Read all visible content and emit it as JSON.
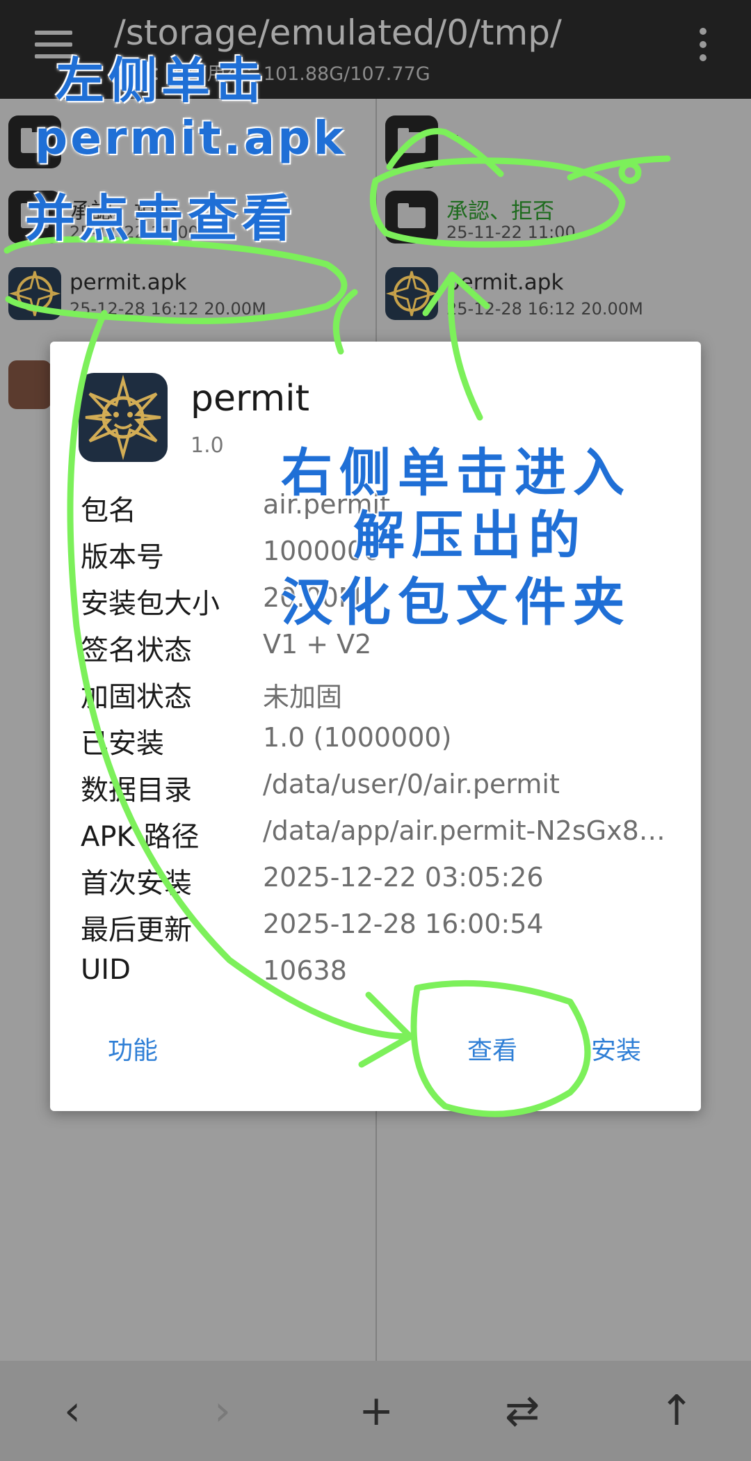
{
  "topbar": {
    "path": "/storage/emulated/0/tmp/",
    "storage_line": "文件：1 可用存：101.88G/107.77G"
  },
  "left_pane": {
    "rows": [
      {
        "name": "..",
        "meta": ""
      },
      {
        "name": "承認、拒否",
        "meta": "25-11-22 11:00"
      },
      {
        "name": "permit.apk",
        "meta": "25-12-28 16:12  20.00M"
      }
    ]
  },
  "right_pane": {
    "rows": [
      {
        "name": "..",
        "meta": ""
      },
      {
        "name": "承認、拒否",
        "meta": "25-11-22 11:00"
      },
      {
        "name": "permit.apk",
        "meta": "25-12-28 16:12  20.00M"
      }
    ]
  },
  "dialog": {
    "app_name": "permit",
    "version": "1.0",
    "rows": [
      {
        "label": "包名",
        "value": "air.permit"
      },
      {
        "label": "版本号",
        "value": "1000000"
      },
      {
        "label": "安装包大小",
        "value": "20.00M"
      },
      {
        "label": "签名状态",
        "value": "V1 + V2"
      },
      {
        "label": "加固状态",
        "value": "未加固"
      },
      {
        "label": "已安装",
        "value": "1.0 (1000000)"
      },
      {
        "label": "数据目录",
        "value": "/data/user/0/air.permit"
      },
      {
        "label": "APK 路径",
        "value": "/data/app/air.permit-N2sGx8eH…"
      },
      {
        "label": "首次安装",
        "value": "2025-12-22 03:05:26"
      },
      {
        "label": "最后更新",
        "value": "2025-12-28 16:00:54"
      },
      {
        "label": "UID",
        "value": "10638"
      }
    ],
    "buttons": {
      "functions": "功能",
      "view": "查看",
      "install": "安装"
    }
  },
  "bottombar": {
    "icons": [
      "chevron-left-icon",
      "chevron-right-icon",
      "plus-icon",
      "swap-icon",
      "arrow-up-icon"
    ],
    "glyphs": {
      "back": "‹",
      "forward": "›",
      "add": "+",
      "swap": "⇄",
      "up": "↑"
    }
  },
  "annotations": {
    "left_line1": "左侧单击",
    "left_line2": "permit.apk",
    "left_line3": "并点击查看",
    "right_line1": "右侧单击进入",
    "right_line2": "解压出的",
    "right_line3": "汉化包文件夹",
    "color": "#1f6fd6",
    "scribble_color": "#7cf05a"
  }
}
